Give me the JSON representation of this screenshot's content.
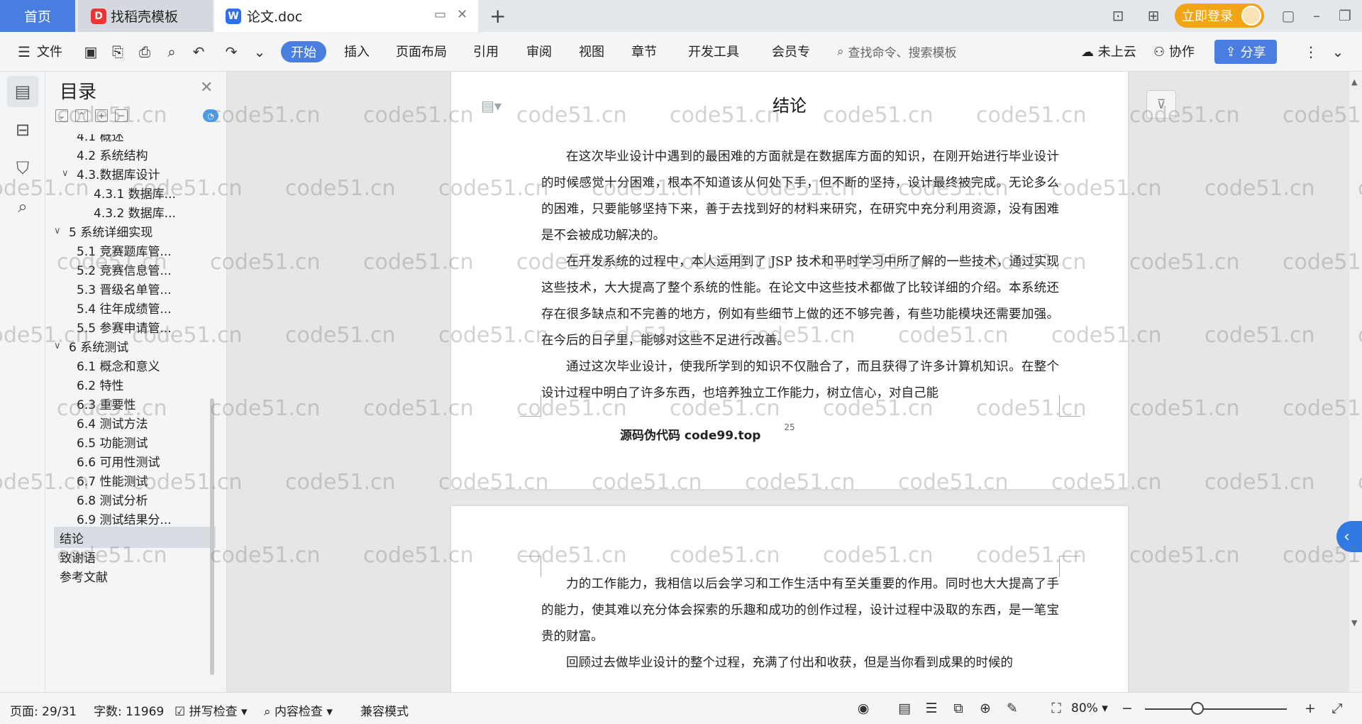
{
  "tabs": {
    "home": "首页",
    "template": "找稻壳模板",
    "document": "论文.doc"
  },
  "titlebar": {
    "login": "立即登录"
  },
  "menu": {
    "file": "文件",
    "items": [
      "开始",
      "插入",
      "页面布局",
      "引用",
      "审阅",
      "视图",
      "章节",
      "开发工具",
      "会员专"
    ],
    "search_placeholder": "查找命令、搜索模板",
    "cloud": "未上云",
    "collab": "协作",
    "share": "分享"
  },
  "toc": {
    "title": "目录",
    "items": [
      {
        "label": "4.1 概述",
        "level": 2,
        "caret": ""
      },
      {
        "label": "4.2 系统结构",
        "level": 2,
        "caret": ""
      },
      {
        "label": "4.3.数据库设计",
        "level": 2,
        "caret": "∨"
      },
      {
        "label": "4.3.1 数据库...",
        "level": 3,
        "caret": ""
      },
      {
        "label": "4.3.2 数据库...",
        "level": 3,
        "caret": ""
      },
      {
        "label": "5 系统详细实现",
        "level": 1,
        "caret": "∨"
      },
      {
        "label": "5.1  竞赛题库管...",
        "level": 2,
        "caret": ""
      },
      {
        "label": "5.2  竞赛信息管...",
        "level": 2,
        "caret": ""
      },
      {
        "label": "5.3  晋级名单管...",
        "level": 2,
        "caret": ""
      },
      {
        "label": "5.4  往年成绩管...",
        "level": 2,
        "caret": ""
      },
      {
        "label": "5.5  参赛申请管...",
        "level": 2,
        "caret": ""
      },
      {
        "label": "6 系统测试",
        "level": 1,
        "caret": "∨"
      },
      {
        "label": "6.1 概念和意义",
        "level": 2,
        "caret": ""
      },
      {
        "label": "6.2 特性",
        "level": 2,
        "caret": ""
      },
      {
        "label": "6.3 重要性",
        "level": 2,
        "caret": ""
      },
      {
        "label": "6.4 测试方法",
        "level": 2,
        "caret": ""
      },
      {
        "label": "6.5  功能测试",
        "level": 2,
        "caret": ""
      },
      {
        "label": "6.6 可用性测试",
        "level": 2,
        "caret": ""
      },
      {
        "label": "6.7 性能测试",
        "level": 2,
        "caret": ""
      },
      {
        "label": "6.8 测试分析",
        "level": 2,
        "caret": ""
      },
      {
        "label": "6.9 测试结果分...",
        "level": 2,
        "caret": ""
      },
      {
        "label": "结论",
        "level": 1,
        "caret": "",
        "selected": true
      },
      {
        "label": "致谢语",
        "level": 1,
        "caret": ""
      },
      {
        "label": "参考文献",
        "level": 1,
        "caret": ""
      }
    ]
  },
  "document": {
    "heading": "结论",
    "page1_paragraphs": [
      "在这次毕业设计中遇到的最困难的方面就是在数据库方面的知识，在刚开始进行毕业设计的时候感觉十分困难，根本不知道该从何处下手，但不断的坚持，设计最终被完成。无论多么的困难，只要能够坚持下来，善于去找到好的材料来研究，在研究中充分利用资源，没有困难是不会被成功解决的。",
      "在开发系统的过程中，本人运用到了 JSP 技术和平时学习中所了解的一些技术，通过实现这些技术，大大提高了整个系统的性能。在论文中这些技术都做了比较详细的介绍。本系统还存在很多缺点和不完善的地方，例如有些细节上做的还不够完善，有些功能模块还需要加强。在今后的日子里，能够对这些不足进行改善。",
      "通过这次毕业设计，使我所学到的知识不仅融合了，而且获得了许多计算机知识。在整个设计过程中明白了许多东西，也培养独立工作能力，树立信心，对自己能"
    ],
    "source_note": "源码伪代码 code99.top",
    "page_number": "25",
    "page2_paragraphs": [
      "力的工作能力，我相信以后会学习和工作生活中有至关重要的作用。同时也大大提高了手的能力，使其难以充分体会探索的乐趣和成功的创作过程，设计过程中汲取的东西，是一笔宝贵的财富。",
      "回顾过去做毕业设计的整个过程，充满了付出和收获，但是当你看到成果的时候的"
    ],
    "watermark": "code51.cn"
  },
  "status": {
    "page": "页面: 29/31",
    "words": "字数: 11969",
    "spell": "拼写检查",
    "content": "内容检查",
    "compat": "兼容模式",
    "zoom": "80%",
    "zoom_level_percent": 80
  }
}
